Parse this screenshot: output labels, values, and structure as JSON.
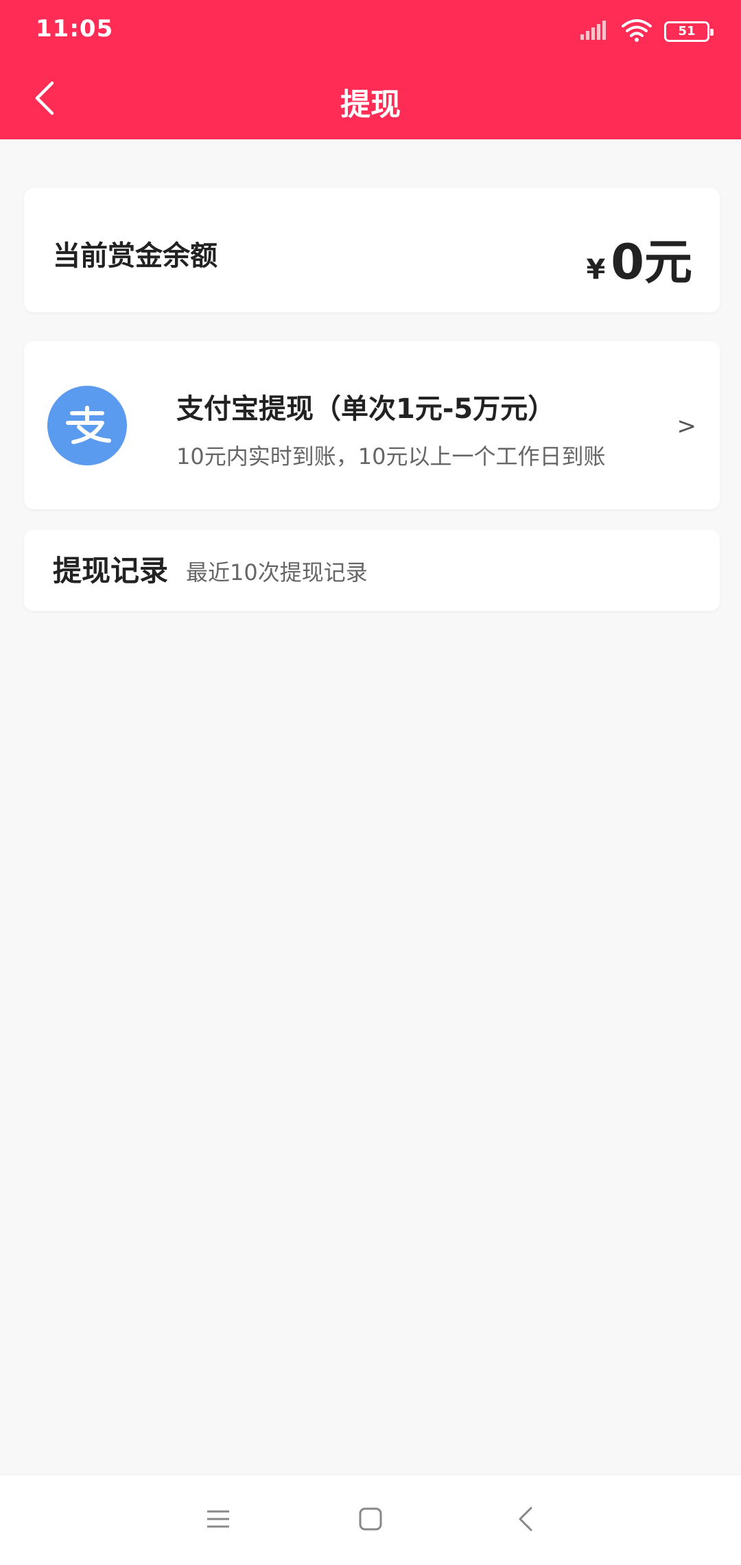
{
  "colors": {
    "brand": "#ff2c55",
    "alipay": "#5a9bf0",
    "text_primary": "#222222",
    "text_secondary": "#666666"
  },
  "status_bar": {
    "time": "11:05",
    "battery_level": "51",
    "icons": [
      "signal-icon",
      "wifi-icon",
      "battery-icon"
    ]
  },
  "header": {
    "title": "提现",
    "back_icon": "back-arrow-icon"
  },
  "balance": {
    "label": "当前赏金余额",
    "currency": "¥",
    "amount": "0元"
  },
  "alipay": {
    "icon": "alipay-icon",
    "title": "支付宝提现（单次1元-5万元）",
    "description": "10元内实时到账，10元以上一个工作日到账",
    "arrow": ">"
  },
  "records": {
    "title": "提现记录",
    "subtitle": "最近10次提现记录"
  },
  "nav_bar": {
    "icons": [
      "menu-icon",
      "home-icon",
      "back-icon"
    ]
  }
}
